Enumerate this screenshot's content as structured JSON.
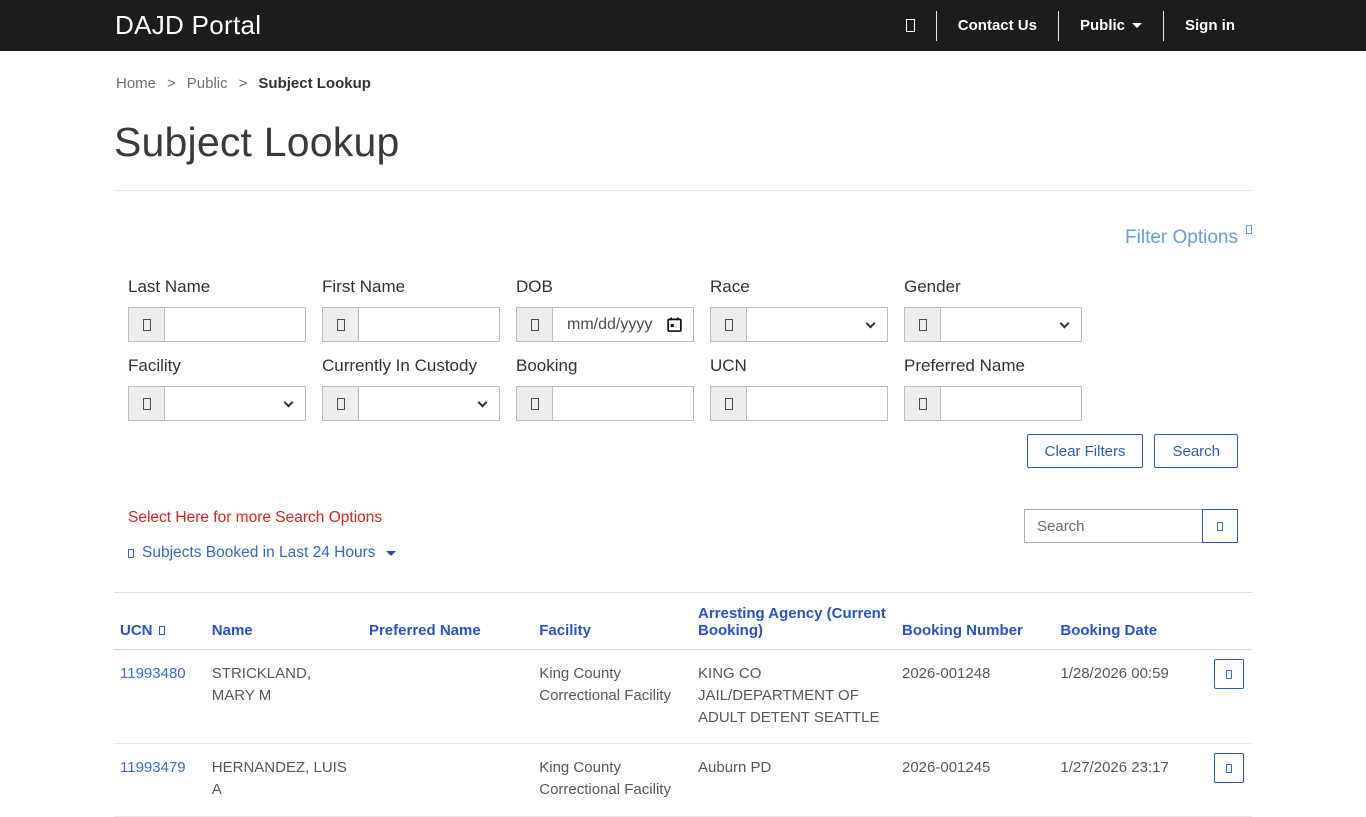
{
  "navbar": {
    "brand": "DAJD Portal",
    "links": {
      "contact": "Contact Us",
      "public": "Public",
      "signin": "Sign in"
    }
  },
  "breadcrumb": {
    "separator": ">",
    "items": {
      "home": "Home",
      "public": "Public",
      "current": "Subject Lookup"
    }
  },
  "page": {
    "title": "Subject Lookup"
  },
  "filter": {
    "options_label": "Filter Options",
    "fields": [
      {
        "label": "Last Name",
        "type": "text",
        "value": ""
      },
      {
        "label": "First Name",
        "type": "text",
        "value": ""
      },
      {
        "label": "DOB",
        "type": "date",
        "placeholder": "mm/dd/yyyy"
      },
      {
        "label": "Race",
        "type": "select",
        "value": ""
      },
      {
        "label": "Gender",
        "type": "select",
        "value": ""
      },
      {
        "label": "Facility",
        "type": "select",
        "value": ""
      },
      {
        "label": "Currently In Custody",
        "type": "select",
        "value": ""
      },
      {
        "label": "Booking",
        "type": "text",
        "value": ""
      },
      {
        "label": "UCN",
        "type": "text",
        "value": ""
      },
      {
        "label": "Preferred Name",
        "type": "text",
        "value": ""
      }
    ],
    "clear_label": "Clear Filters",
    "search_label": "Search"
  },
  "actions": {
    "more_options": "Select Here for more Search Options",
    "booked_link": "Subjects Booked in Last 24 Hours",
    "table_search_placeholder": "Search"
  },
  "table": {
    "columns": [
      "UCN",
      "Name",
      "Preferred Name",
      "Facility",
      "Arresting Agency (Current Booking)",
      "Booking Number",
      "Booking Date"
    ],
    "rows": [
      {
        "ucn": "11993480",
        "name": "STRICKLAND, MARY M",
        "preferred_name": "",
        "facility": "King County Correctional Facility",
        "arresting_agency": "KING CO JAIL/DEPARTMENT OF ADULT DETENT SEATTLE",
        "booking_number": "2026-001248",
        "booking_date": "1/28/2026 00:59"
      },
      {
        "ucn": "11993479",
        "name": "HERNANDEZ, LUIS A",
        "preferred_name": "",
        "facility": "King County Correctional Facility",
        "arresting_agency": "Auburn PD",
        "booking_number": "2026-001245",
        "booking_date": "1/27/2026 23:17"
      }
    ]
  },
  "colors": {
    "navbar_bg": "#1c1c1c",
    "accent_blue": "#2e5cb8",
    "header_blue": "#2a52c9",
    "link_blue": "#3d6ad1",
    "light_blue": "#6d9be0",
    "alert_red": "#d9251d"
  }
}
